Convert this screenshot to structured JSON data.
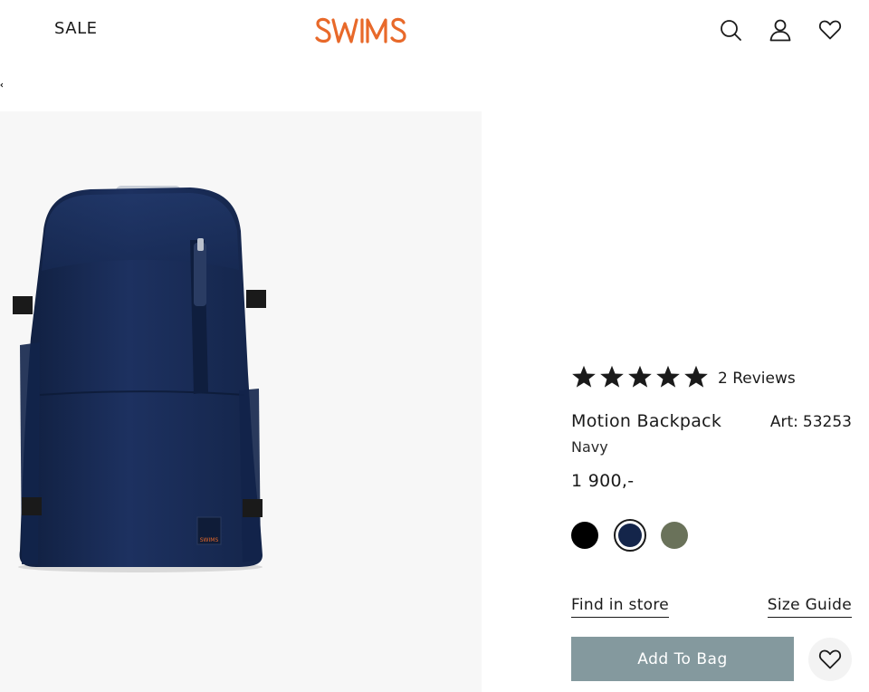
{
  "header": {
    "sale_label": "SALE",
    "logo_text": "SWIMS",
    "icons": [
      "search-icon",
      "account-icon",
      "heart-icon"
    ]
  },
  "product": {
    "rating": 5,
    "rating_max": 5,
    "reviews_label": "2 Reviews",
    "name": "Motion Backpack",
    "art_label": "Art:",
    "art_number": "53253",
    "color_name": "Navy",
    "price": "1 900,-",
    "swatches": [
      {
        "name": "black",
        "color": "#000000",
        "selected": false
      },
      {
        "name": "navy",
        "color": "#14254a",
        "selected": true
      },
      {
        "name": "olive",
        "color": "#6a725a",
        "selected": false
      }
    ],
    "image_label": "SWIMS"
  },
  "links": {
    "find_in_store": "Find in store",
    "size_guide": "Size Guide"
  },
  "actions": {
    "add_to_bag": "Add To Bag"
  },
  "colors": {
    "brand": "#e8692a",
    "button": "#84999e",
    "gallery_bg": "#f7f7f7"
  }
}
